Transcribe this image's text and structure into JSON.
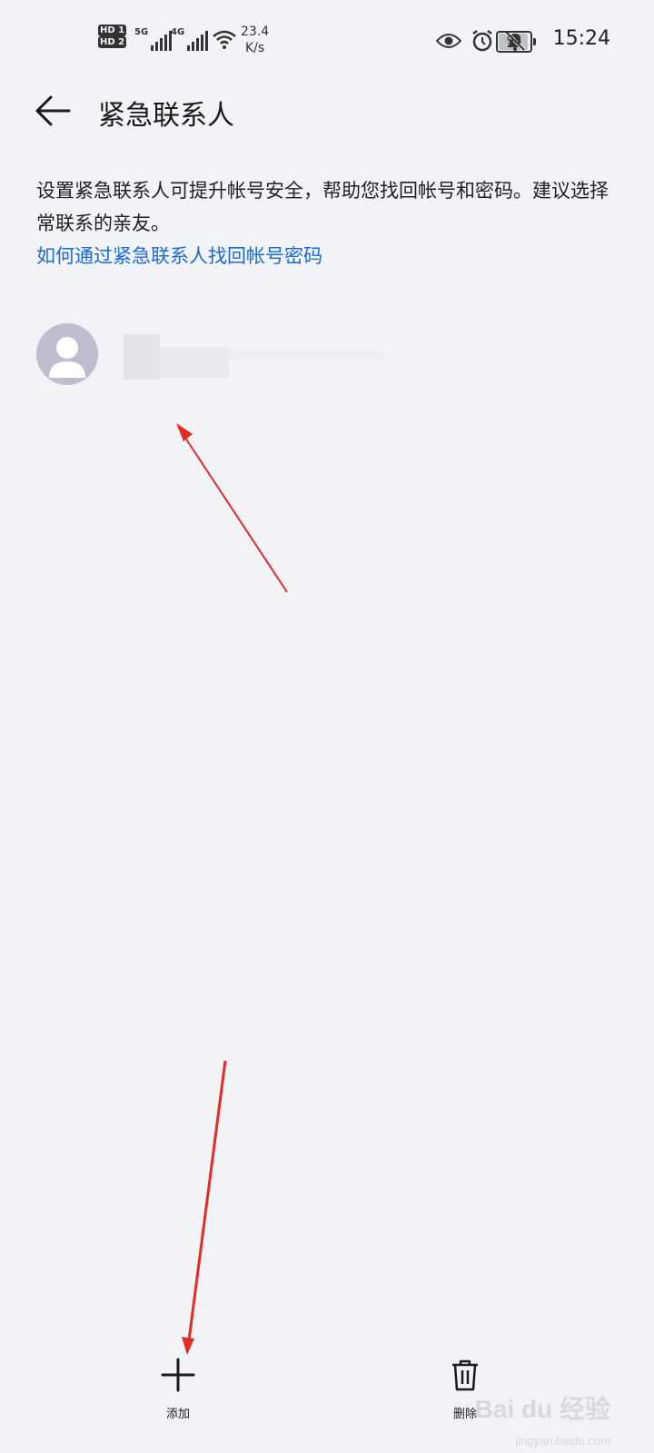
{
  "status_bar": {
    "sim1": "HD 1",
    "sim2": "HD 2",
    "net1": "5G",
    "net2": "4G",
    "speed_value": "23.4",
    "speed_unit": "K/s",
    "battery": "94",
    "time": "15:24",
    "icons": [
      "eye-icon",
      "alarm-icon",
      "mute-icon"
    ]
  },
  "header": {
    "title": "紧急联系人",
    "back_icon": "back-arrow-icon"
  },
  "intro": {
    "description": "设置紧急联系人可提升帐号安全，帮助您找回帐号和密码。建议选择常联系的亲友。",
    "help_link": "如何通过紧急联系人找回帐号密码"
  },
  "contacts": [
    {
      "avatar_icon": "person-icon",
      "name": ""
    }
  ],
  "bottom_bar": {
    "add_label": "添加",
    "delete_label": "删除"
  },
  "watermark": {
    "text": "Bai du 经验",
    "sub": "jingyan.baidu.com"
  },
  "colors": {
    "background": "#f1f3f6",
    "link": "#1a6ad6",
    "avatar": "#c1bcd0",
    "annotation_arrow": "#e52b25"
  }
}
